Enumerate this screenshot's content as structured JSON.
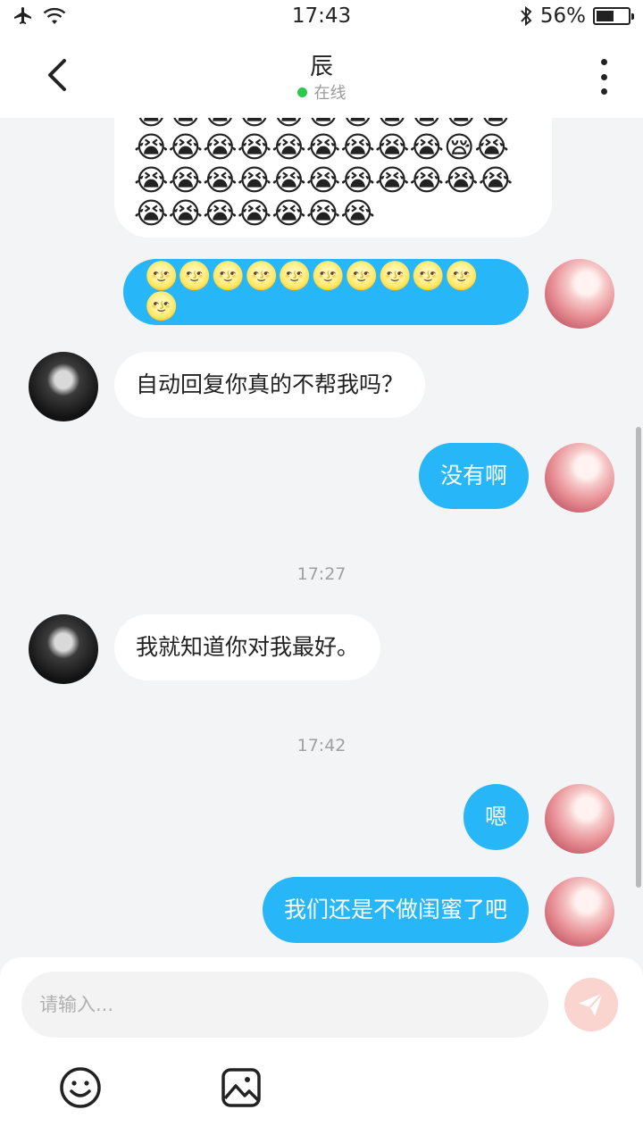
{
  "status_bar": {
    "time": "17:43",
    "battery_text": "56%",
    "battery_level": 0.56
  },
  "header": {
    "title": "辰",
    "presence": "在线"
  },
  "messages": [
    {
      "side": "in",
      "kind": "emoji",
      "rows": [
        [
          "😭",
          "😭",
          "😭",
          "😭",
          "😭",
          "😭",
          "😭",
          "😭",
          "😭",
          "😭",
          "😭"
        ],
        [
          "😭",
          "😭",
          "😭",
          "😭",
          "😭",
          "😭",
          "😭",
          "😭",
          "😭",
          "😪",
          "😭"
        ],
        [
          "😭",
          "😭",
          "😭",
          "😭",
          "😭",
          "😭",
          "😭",
          "😭",
          "😭",
          "😭",
          "😭"
        ],
        [
          "😭",
          "😭",
          "😭",
          "😭",
          "😭",
          "😭",
          "😭"
        ]
      ]
    },
    {
      "side": "out",
      "kind": "emoji",
      "rows": [
        [
          "🌝",
          "🌝",
          "🌝",
          "🌝",
          "🌝",
          "🌝",
          "🌝",
          "🌝",
          "🌝",
          "🌝",
          "🌝"
        ]
      ]
    },
    {
      "side": "in",
      "text": "自动回复你真的不帮我吗？"
    },
    {
      "side": "out",
      "text": "没有啊"
    },
    {
      "kind": "time",
      "text": "17:27"
    },
    {
      "side": "in",
      "text": "我就知道你对我最好。"
    },
    {
      "kind": "time",
      "text": "17:42"
    },
    {
      "side": "out",
      "text": "嗯"
    },
    {
      "side": "out",
      "text": "我们还是不做闺蜜了吧"
    }
  ],
  "composer": {
    "placeholder": "请输入..."
  },
  "icons": {
    "back": "chevron-left-icon",
    "menu": "more-vertical-icon",
    "send": "paper-plane-icon",
    "emoji": "smiley-icon",
    "image": "image-icon"
  },
  "colors": {
    "out_bubble": "#27b6f7",
    "online": "#2cc84a",
    "send_disabled": "#fad4cf"
  }
}
